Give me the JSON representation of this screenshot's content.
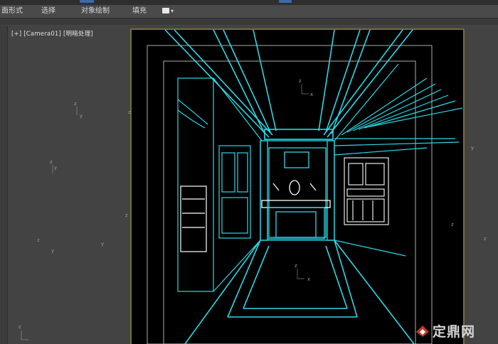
{
  "ribbon": {
    "tabs": [
      "面形式",
      "选择",
      "对象绘制",
      "填充"
    ]
  },
  "viewport": {
    "label": "[+] [Camera01] [明暗处理]"
  },
  "watermark": {
    "text": "定鼎网"
  },
  "colors": {
    "wire_cyan": "#2ad9e6",
    "wire_white": "#ffffff",
    "wire_yellow": "#c8b64a",
    "viewport_bg": "#434343",
    "safe_frame": "#a89a3a"
  },
  "icons": [
    "dropdown-icon",
    "axis-gizmo-icon",
    "watermark-logo-icon"
  ]
}
